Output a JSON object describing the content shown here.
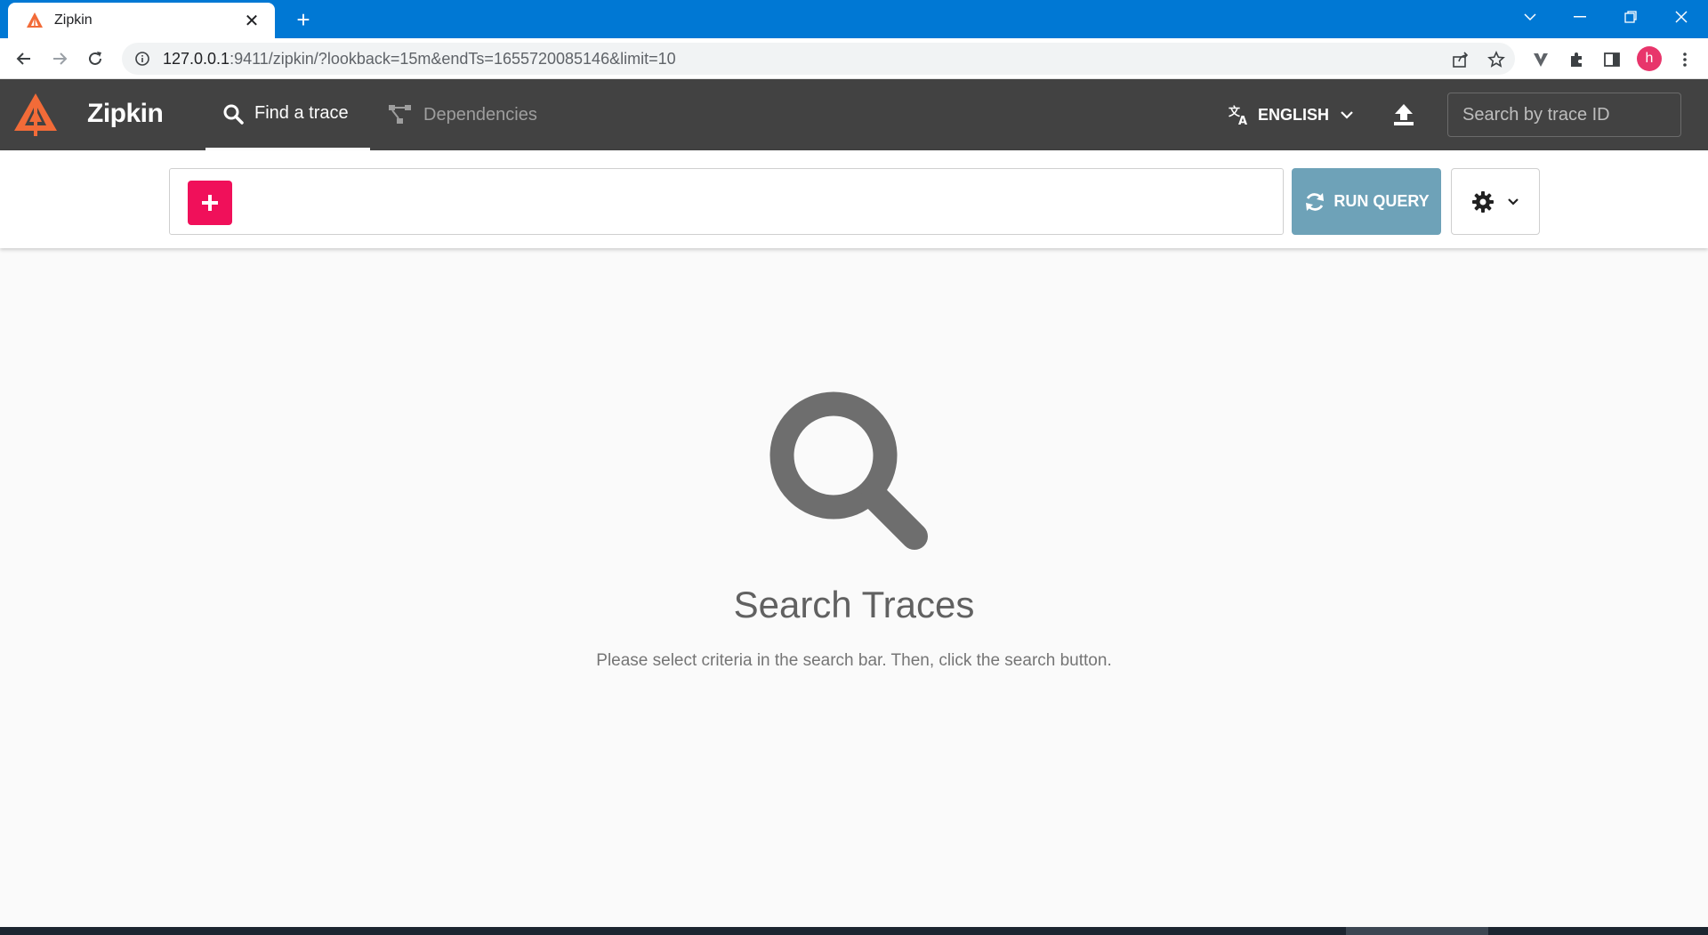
{
  "browser": {
    "tab_title": "Zipkin",
    "url_host": "127.0.0.1",
    "url_rest": ":9411/zipkin/?lookback=15m&endTs=1655720085146&limit=10",
    "avatar_letter": "h"
  },
  "app": {
    "brand": "Zipkin",
    "nav": {
      "find_trace": "Find a trace",
      "dependencies": "Dependencies"
    },
    "language": "ENGLISH",
    "trace_search_placeholder": "Search by trace ID"
  },
  "query": {
    "run_label": "RUN QUERY"
  },
  "empty": {
    "title": "Search Traces",
    "description": "Please select criteria in the search bar. Then, click the search button."
  },
  "colors": {
    "accent": "#f0105a",
    "run_button": "#6ea2b8",
    "appbar": "#424242",
    "logo": "#f26b38"
  }
}
